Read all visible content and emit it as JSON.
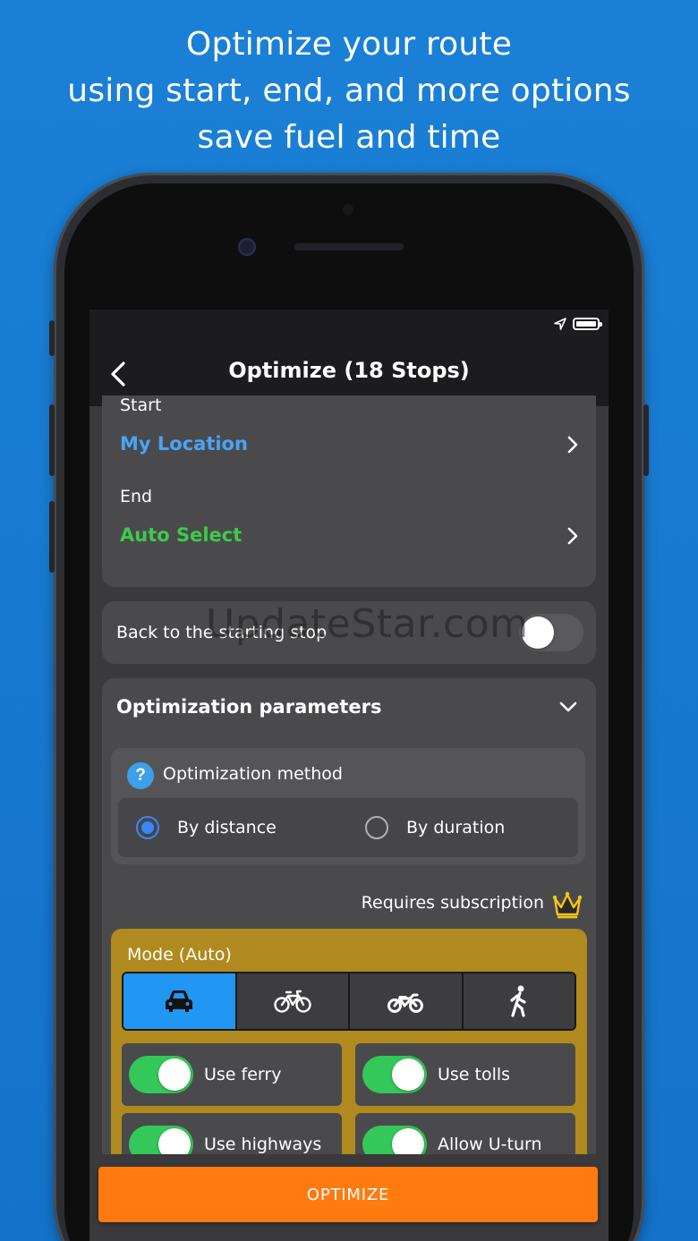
{
  "headline": {
    "line1": "Optimize your route",
    "line2": "using start, end, and more options",
    "line3": "save fuel and time"
  },
  "nav": {
    "title": "Optimize (18 Stops)",
    "back_icon": "chevron-left-icon"
  },
  "start_end": {
    "start_label": "Start",
    "start_value": "My Location",
    "end_label": "End",
    "end_value": "Auto Select",
    "start_color": "#4aa3f5",
    "end_color": "#3ccb4a"
  },
  "back_to_start": {
    "label": "Back to the starting stop",
    "enabled": false
  },
  "watermark": "UpdateStar.com",
  "optimization": {
    "title": "Optimization parameters",
    "method_title": "Optimization method",
    "options": [
      "By distance",
      "By duration"
    ],
    "selected": "By distance"
  },
  "subscription": {
    "label": "Requires subscription",
    "icon": "crown-icon"
  },
  "mode": {
    "label": "Mode (Auto)",
    "items": [
      "car-icon",
      "bicycle-icon",
      "motorcycle-icon",
      "walking-icon"
    ],
    "selected": "car-icon"
  },
  "toggles": [
    {
      "label": "Use ferry",
      "on": true
    },
    {
      "label": "Use tolls",
      "on": true
    },
    {
      "label": "Use highways",
      "on": true
    },
    {
      "label": "Allow U-turn",
      "on": true
    }
  ],
  "action": {
    "optimize_label": "OPTIMIZE",
    "color": "#ff7a0f"
  }
}
